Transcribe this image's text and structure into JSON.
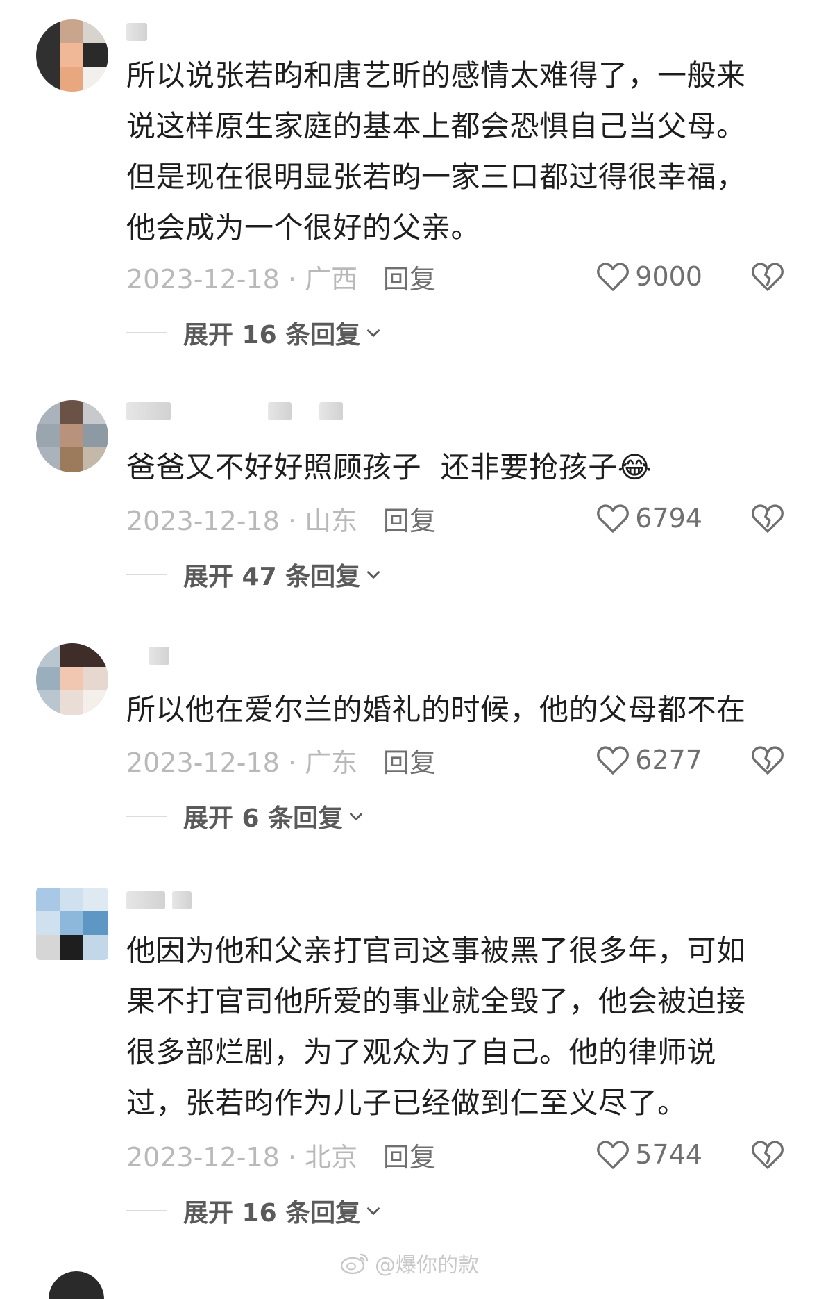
{
  "comments": [
    {
      "text": "所以说张若昀和唐艺昕的感情太难得了，一般来说这样原生家庭的基本上都会恐惧自己当父母。但是现在很明显张若昀一家三口都过得很幸福，他会成为一个很好的父亲。",
      "date_location": "2023-12-18 · 广西",
      "reply_label": "回复",
      "likes": "9000",
      "expand_label": "展开 16 条回复"
    },
    {
      "text": "爸爸又不好好照顾孩子  还非要抢孩子",
      "emoji": "😂",
      "date_location": "2023-12-18 · 山东",
      "reply_label": "回复",
      "likes": "6794",
      "expand_label": "展开 47 条回复"
    },
    {
      "text": "所以他在爱尔兰的婚礼的时候，他的父母都不在",
      "date_location": "2023-12-18 · 广东",
      "reply_label": "回复",
      "likes": "6277",
      "expand_label": "展开 6 条回复"
    },
    {
      "text": "他因为他和父亲打官司这事被黑了很多年，可如果不打官司他所爱的事业就全毁了，他会被迫接很多部烂剧，为了观众为了自己。他的律师说过，张若昀作为儿子已经做到仁至义尽了。",
      "date_location": "2023-12-18 · 北京",
      "reply_label": "回复",
      "likes": "5744",
      "expand_label": "展开 16 条回复"
    }
  ],
  "watermark": "@爆你的款",
  "icons": {
    "like": "heart-outline-icon",
    "dislike": "broken-heart-icon",
    "expand": "chevron-down-icon",
    "watermark": "weibo-icon"
  },
  "colors": {
    "text": "#1e1e1e",
    "date": "#b9b9b9",
    "secondary": "#6f6f6f",
    "expand": "#5a5a5a"
  }
}
